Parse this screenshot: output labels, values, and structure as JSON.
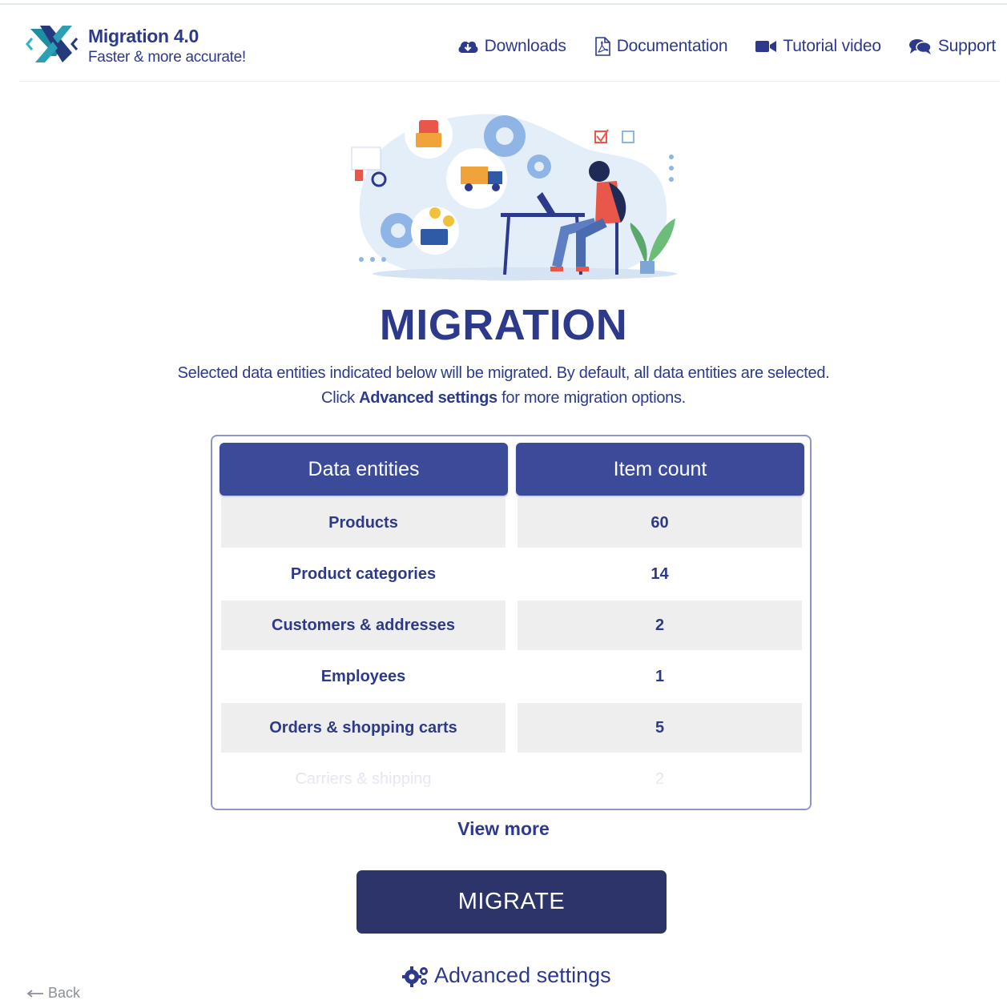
{
  "header": {
    "brand_title": "Migration 4.0",
    "brand_subtitle": "Faster & more accurate!",
    "nav": [
      {
        "label": "Downloads",
        "icon": "cloud-download-icon"
      },
      {
        "label": "Documentation",
        "icon": "pdf-document-icon"
      },
      {
        "label": "Tutorial video",
        "icon": "video-camera-icon"
      },
      {
        "label": "Support",
        "icon": "chat-bubbles-icon"
      }
    ]
  },
  "main": {
    "title": "MIGRATION",
    "description_line1": "Selected data entities indicated below will be migrated. By default, all data entities are selected.",
    "description_line2_prefix": "Click",
    "description_line2_bold": "Advanced settings",
    "description_line2_suffix": "for more migration options."
  },
  "table": {
    "headers": [
      "Data entities",
      "Item count"
    ],
    "rows": [
      {
        "entity": "Products",
        "count": "60"
      },
      {
        "entity": "Product categories",
        "count": "14"
      },
      {
        "entity": "Customers & addresses",
        "count": "2"
      },
      {
        "entity": "Employees",
        "count": "1"
      },
      {
        "entity": "Orders & shopping carts",
        "count": "5"
      },
      {
        "entity": "Carriers & shipping",
        "count": "2"
      }
    ]
  },
  "actions": {
    "view_more": "View more",
    "migrate": "MIGRATE",
    "advanced_settings": "Advanced settings",
    "back": "Back"
  },
  "colors": {
    "brand": "#2d3a8c",
    "table_header": "#3c4a9a",
    "button": "#2c3469",
    "row_shade": "#eeeeee"
  }
}
